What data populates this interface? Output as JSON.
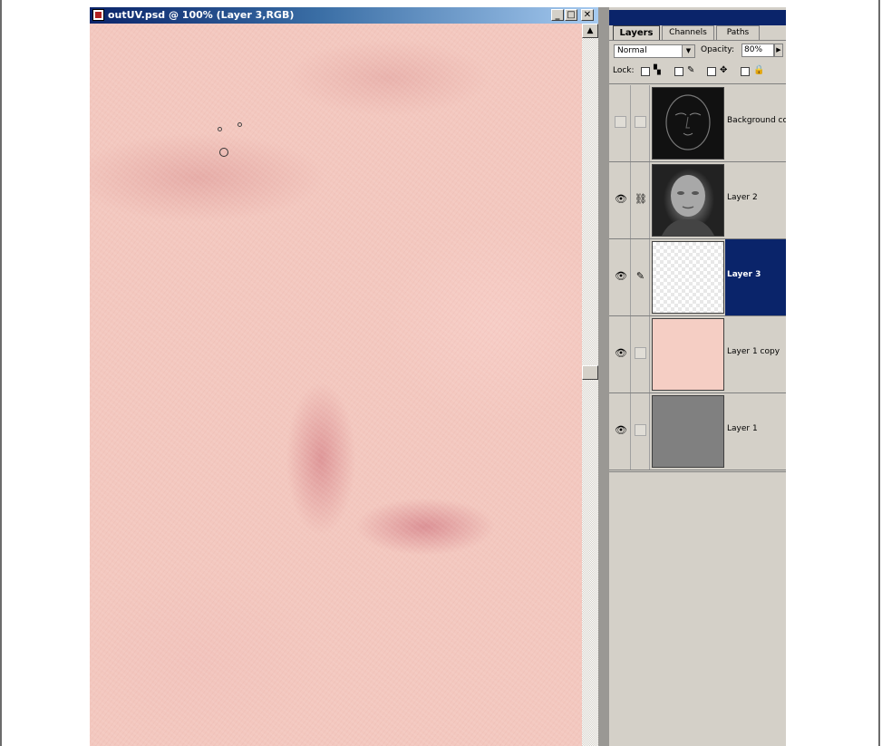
{
  "document": {
    "title": "outUV.psd @ 100% (Layer 3,RGB)",
    "minimize_glyph": "_",
    "maximize_glyph": "□",
    "close_glyph": "✕",
    "scroll_up_glyph": "▲"
  },
  "palette": {
    "tabs": [
      {
        "label": "Layers",
        "active": true
      },
      {
        "label": "Channels",
        "active": false
      },
      {
        "label": "Paths",
        "active": false
      }
    ],
    "blend_mode": "Normal",
    "opacity_label": "Opacity:",
    "opacity_value": "80%",
    "lock_label": "Lock:",
    "layers": [
      {
        "name": "Background co",
        "visible": false,
        "linked": false,
        "paint": false,
        "thumbnail": "dark-face-texture",
        "selected": false
      },
      {
        "name": "Layer 2",
        "visible": true,
        "linked": true,
        "paint": false,
        "thumbnail": "face-render",
        "selected": false
      },
      {
        "name": "Layer 3",
        "visible": true,
        "linked": false,
        "paint": true,
        "thumbnail": "transparent",
        "selected": true
      },
      {
        "name": "Layer 1 copy",
        "visible": true,
        "linked": false,
        "paint": false,
        "thumbnail": "skin-texture",
        "selected": false
      },
      {
        "name": "Layer 1",
        "visible": true,
        "linked": false,
        "paint": false,
        "thumbnail": "gray-fill",
        "selected": false
      }
    ]
  },
  "icons": {
    "eye": "eye-icon",
    "brush": "brush-icon",
    "link": "link-icon",
    "lock": "lock-icon",
    "move": "move-icon"
  },
  "colors": {
    "selection": "#0a246a",
    "skin": "#f3c8bf",
    "panel": "#d4d0c8"
  }
}
